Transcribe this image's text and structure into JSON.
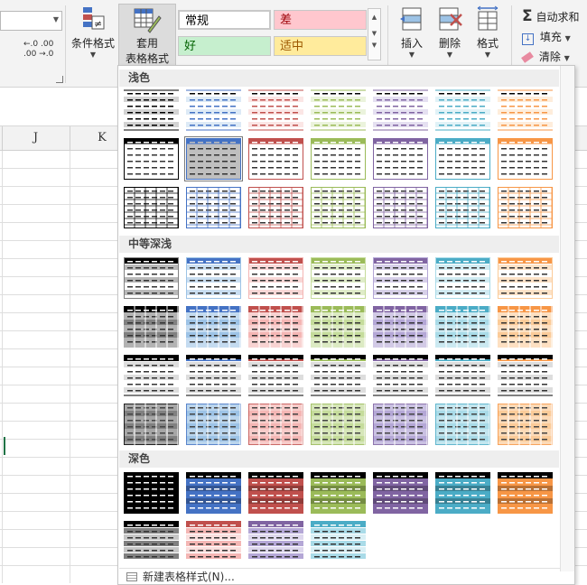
{
  "ribbon": {
    "number_combo_value": "",
    "decimal_increase": "←.0 .00",
    "decimal_decrease": ".00 →.0",
    "conditional_format_label": "条件格式",
    "format_as_table_label_line1": "套用",
    "format_as_table_label_line2": "表格格式",
    "cell_styles": [
      {
        "label": "常规",
        "bg": "#ffffff",
        "color": "#000000"
      },
      {
        "label": "差",
        "bg": "#ffc7ce",
        "color": "#9c0006"
      },
      {
        "label": "好",
        "bg": "#c6efce",
        "color": "#006100"
      },
      {
        "label": "适中",
        "bg": "#ffeb9c",
        "color": "#9c5700"
      }
    ],
    "insert_label": "插入",
    "delete_label": "删除",
    "format_label": "格式",
    "autosum_label": "自动求和",
    "fill_label": "填充",
    "clear_label": "清除"
  },
  "sheet": {
    "columns": [
      "J",
      "K"
    ]
  },
  "gallery": {
    "sections": [
      {
        "title": "浅色",
        "key": "light"
      },
      {
        "title": "中等深浅",
        "key": "medium"
      },
      {
        "title": "深色",
        "key": "dark"
      }
    ],
    "new_style_label": "新建表格样式(N)...",
    "palette": [
      "#000000",
      "#4472c4",
      "#c0504d",
      "#9bbb59",
      "#8064a2",
      "#4bacc6",
      "#f79646"
    ],
    "light_palette": [
      "#808080",
      "#9dc3e6",
      "#f4b6b4",
      "#c5dc9b",
      "#b4a7d6",
      "#a9dbe8",
      "#fbcb99"
    ],
    "selected_style": "light-row2-col2"
  }
}
